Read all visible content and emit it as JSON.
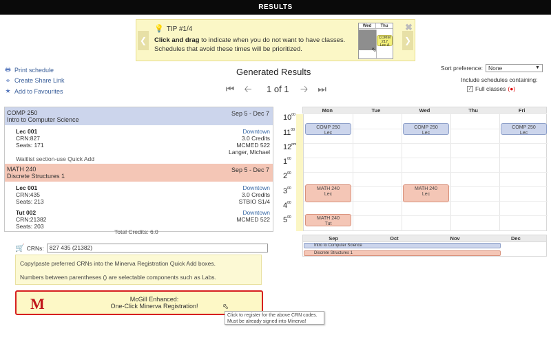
{
  "topbar": {
    "title": "RESULTS"
  },
  "tip": {
    "heading": "TIP #1/4",
    "bold": "Click and drag",
    "text": " to indicate when you do not want to have classes. Schedules that avoid these times will be prioritized.",
    "mini_days": [
      "Wed",
      "Thu"
    ],
    "mini_event": [
      "COMM",
      "217",
      "Lec A"
    ]
  },
  "side_links": [
    "Print schedule",
    "Create Share Link",
    "Add to Favourites"
  ],
  "generated": {
    "title": "Generated Results",
    "counter": "1 of 1"
  },
  "sort": {
    "label": "Sort preference:",
    "value": "None",
    "include_label": "Include schedules containing:",
    "full_classes_label": "Full classes",
    "full_classes_checked": "✓",
    "full_classes_marker": "(●)"
  },
  "courses": [
    {
      "code": "COMP 250",
      "title": "Intro to Computer Science",
      "dates": "Sep 5 - Dec 7",
      "color": "#ccd5ec",
      "sections": [
        {
          "name": "Lec 001",
          "crn": "CRN:827",
          "seats": "Seats: 171",
          "campus": "Downtown",
          "credits": "3.0 Credits",
          "room": "MCMED 522",
          "instructor": "Langer, Michael"
        }
      ],
      "waitlist": "Waitlist section-use Quick Add"
    },
    {
      "code": "MATH 240",
      "title": "Discrete Structures 1",
      "dates": "Sep 5 - Dec 7",
      "color": "#f4c6b6",
      "sections": [
        {
          "name": "Lec 001",
          "crn": "CRN:435",
          "seats": "Seats: 213",
          "campus": "Downtown",
          "credits": "3.0 Credits",
          "room": "STBIO S1/4"
        },
        {
          "name": "Tut 002",
          "crn": "CRN:21382",
          "seats": "Seats: 203",
          "campus": "Downtown",
          "room": "MCMED 522"
        }
      ]
    }
  ],
  "total_credits": "Total Credits: 6.0",
  "crn": {
    "label": "CRNs:",
    "value": "827 435 (21382)",
    "tip_line1": "Copy/paste preferred CRNs into the Minerva Registration Quick Add boxes.",
    "tip_line2": "Numbers between parentheses () are selectable components such as Labs."
  },
  "minerva_button": {
    "logo": "M",
    "line1": "McGill Enhanced:",
    "line2": "One-Click Minerva Registration!"
  },
  "tooltip": {
    "line1": "Click to register for the above CRN codes.",
    "line2": "Must be already signed into Minerva!"
  },
  "calendar": {
    "days": [
      "Mon",
      "Tue",
      "Wed",
      "Thu",
      "Fri"
    ],
    "hours": [
      {
        "h": "10",
        "s": "00"
      },
      {
        "h": "11",
        "s": "00"
      },
      {
        "h": "12",
        "s": "pm"
      },
      {
        "h": "1",
        "s": "00"
      },
      {
        "h": "2",
        "s": "00"
      },
      {
        "h": "3",
        "s": "00"
      },
      {
        "h": "4",
        "s": "00"
      },
      {
        "h": "5",
        "s": "00"
      }
    ],
    "events": [
      {
        "l1": "COMP 250",
        "l2": "Lec",
        "day": "Mon"
      },
      {
        "l1": "COMP 250",
        "l2": "Lec",
        "day": "Wed"
      },
      {
        "l1": "COMP 250",
        "l2": "Lec",
        "day": "Fri"
      },
      {
        "l1": "MATH 240",
        "l2": "Lec",
        "day": "Mon"
      },
      {
        "l1": "MATH 240",
        "l2": "Lec",
        "day": "Wed"
      },
      {
        "l1": "MATH 240",
        "l2": "Tut",
        "day": "Mon"
      }
    ]
  },
  "timeline": {
    "months": [
      "Sep",
      "Oct",
      "Nov",
      "Dec"
    ],
    "bars": [
      "Intro to Computer Science",
      "Discrete Structures 1"
    ]
  }
}
